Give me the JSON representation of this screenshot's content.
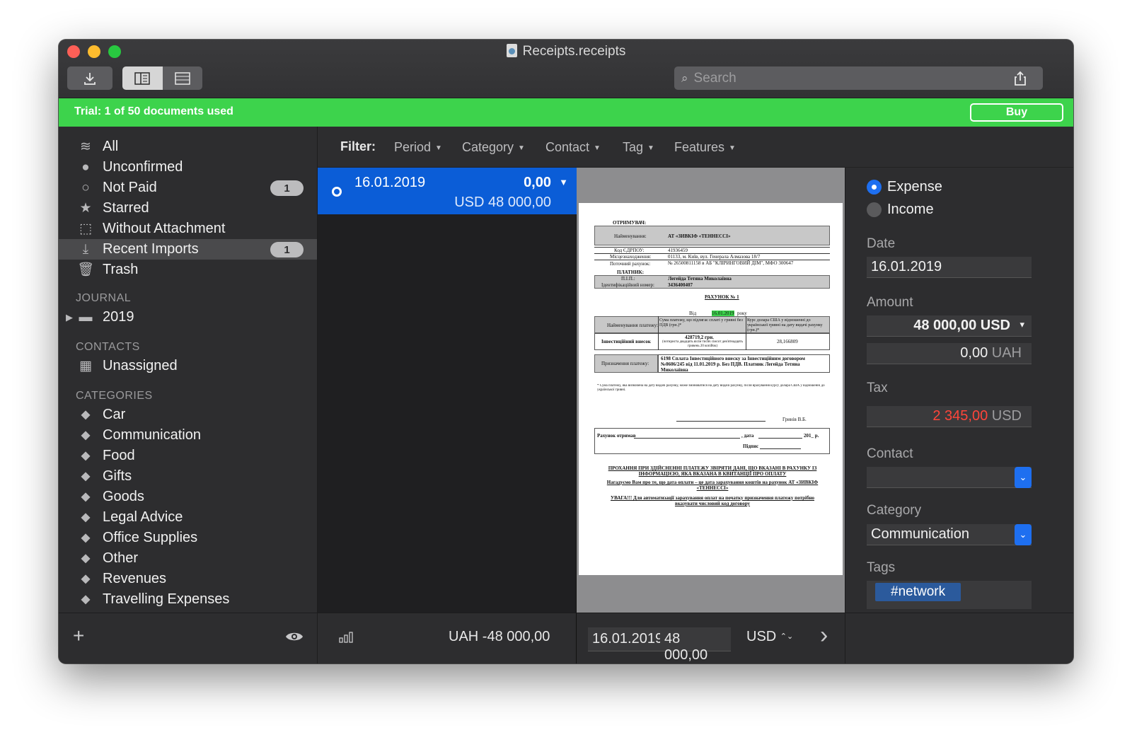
{
  "window": {
    "title": "Receipts.receipts",
    "search_placeholder": "Search"
  },
  "trial": {
    "text": "Trial: 1 of 50 documents used",
    "buy_label": "Buy",
    "color": "#3dd34c"
  },
  "sidebar": {
    "items": [
      {
        "label": "All",
        "icon": "layers-icon"
      },
      {
        "label": "Unconfirmed",
        "icon": "filled-circle-icon"
      },
      {
        "label": "Not Paid",
        "icon": "hollow-circle-icon",
        "badge": "1"
      },
      {
        "label": "Starred",
        "icon": "star-icon"
      },
      {
        "label": "Without Attachment",
        "icon": "dotted-square-icon"
      },
      {
        "label": "Recent Imports",
        "icon": "download-icon",
        "badge": "1"
      },
      {
        "label": "Trash",
        "icon": "trash-icon"
      }
    ],
    "journal_header": "JOURNAL",
    "journal_items": [
      {
        "label": "2019",
        "icon": "folder-icon"
      }
    ],
    "contacts_header": "CONTACTS",
    "contacts_items": [
      {
        "label": "Unassigned",
        "icon": "building-icon"
      }
    ],
    "categories_header": "CATEGORIES",
    "categories": [
      {
        "label": "Car"
      },
      {
        "label": "Communication"
      },
      {
        "label": "Food"
      },
      {
        "label": "Gifts"
      },
      {
        "label": "Goods"
      },
      {
        "label": "Legal Advice"
      },
      {
        "label": "Office Supplies"
      },
      {
        "label": "Other"
      },
      {
        "label": "Revenues"
      },
      {
        "label": "Travelling Expenses"
      }
    ],
    "footer_add": "+",
    "footer_eye": "eye-icon"
  },
  "filter": {
    "label": "Filter:",
    "items": [
      "Period",
      "Category",
      "Contact",
      "Tag",
      "Features"
    ]
  },
  "list": {
    "rows": [
      {
        "date": "16.01.2019",
        "amount": "0,00",
        "sub": "USD 48 000,00",
        "selected": true
      }
    ],
    "footer_total": "UAH -48 000,00",
    "selection_color": "#0b5dd7"
  },
  "preview": {
    "date_field": "16.01.2019",
    "amount_field": "48 000,00",
    "currency": "USD",
    "currency_stepper": "⌃⌄",
    "next_arrow": "›",
    "doc": {
      "recipient": "ОТРИМУВАЧ:",
      "name_lbl": "Найменування:",
      "name_val": "АТ «ЗИВКІФ «ТЕННЕССІ»",
      "edrpou_lbl": "Код ЄДРПОУ:",
      "edrpou_val": "41936459",
      "location_lbl": "Місцезнаходження:",
      "location_val": "01133, м. Київ, вул. Генерала Алмазова 18/7",
      "account_lbl": "Поточний рахунок:",
      "account_val": "№ 26500811158 в АБ \"КЛІРИНГОВИЙ ДІМ\", МФО 300647",
      "payer": "ПЛАТНИК:",
      "pib_lbl": "П.І.П.:",
      "pib_val": "Легейда Тетяна Миколаївна",
      "id_lbl": "Ідентифікаційний номер:",
      "id_val": "3436400407",
      "invoice_title": "РАХУНОК № 1",
      "from_lbl": "Від",
      "from_date": "16.01.2019",
      "from_year": "року",
      "col1": "Найменування платежу:",
      "col2": "Сума платежу, що підлягає сплаті у гривні без ПДВ (грн.)*",
      "col3": "Курс долара США у відношенні до української гривні на дату видачі рахунку (грн.)*",
      "row_lbl": "Інвестиційний внесок",
      "row_sum": "428719,2 грн.",
      "row_sum_words": "(чотириста двадцять вісім тисяч сімсот дев'ятнадцять гривень 20 копійок)",
      "row_rate": "28,166809",
      "purpose_lbl": "Призначення платежу:",
      "purpose_val": "6198 Сплата Інвестиційного внеску за Інвестиційним договором №0606/245 від 11.01.2019 р. Без ПДВ. Платник Легейда Тетяна Миколаївна",
      "footnote": "* Сума платежу, яка визначена на дату видачі рахунку, може змінюватися на дату видачі рахунку, після врахування курсу долара США у відношенні до української гривні.",
      "signer": "Гринів В.Б.",
      "received": "Рахунок отримав",
      "date_lbl": ", дата",
      "year_lbl": "201_ р.",
      "sign_lbl": "Підпис",
      "warn1": "ПРОХАННЯ ПРИ ЗДІЙСНЕННІ ПЛАТЕЖУ ЗВІРЯТИ ДАНІ, ЩО ВКАЗАНІ В РАХУНКУ ІЗ ІНФОРМАЦІЄЮ, ЯКА ВКАЗАНА В КВИТАНЦІЇ ПРО ОПЛАТУ",
      "warn2": "Нагадуємо Вам про те, що дата оплати – це дата зарахування коштів на рахунок АТ «ЗИВКІФ «ТЕННЕССІ»",
      "warn3": "УВАГА!!! Для автоматизації зарахування оплат на початку призначення платежу потрібно вказувати числовий код договору"
    }
  },
  "inspector": {
    "expense_label": "Expense",
    "income_label": "Income",
    "date_label": "Date",
    "date_value": "16.01.2019",
    "amount_label": "Amount",
    "amount_value": "48 000,00 USD",
    "amount_caret": "▾",
    "amount_uah_value": "0,00",
    "amount_uah_currency": "UAH",
    "tax_label": "Tax",
    "tax_value": "2 345,00",
    "tax_currency": "USD",
    "contact_label": "Contact",
    "contact_value": "",
    "category_label": "Category",
    "category_value": "Communication",
    "tags_label": "Tags",
    "tags": [
      "#network"
    ],
    "accent": "#1e6ff0",
    "tax_color": "#ff453a"
  }
}
